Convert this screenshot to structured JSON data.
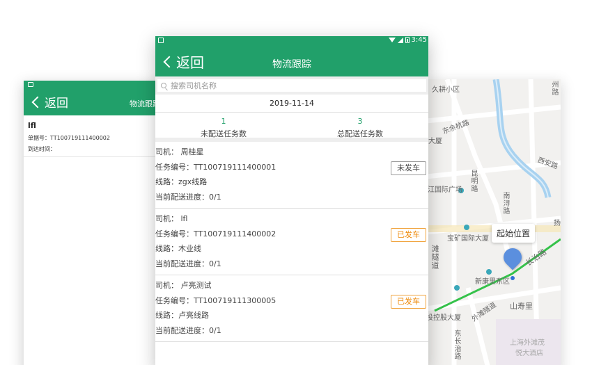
{
  "back_screen": {
    "back_label": "返回",
    "title": "物流跟踪",
    "detail": {
      "name": "lfl",
      "waybill_label": "单据号：",
      "waybill_value": "TT100719111400002",
      "arrival_label": "到达时间："
    }
  },
  "main_screen": {
    "status": {
      "time": "3:45"
    },
    "back_label": "返回",
    "title": "物流跟踪",
    "search": {
      "placeholder": "搜索司机名称"
    },
    "date": "2019-11-14",
    "stats": [
      {
        "value": "1",
        "label": "未配送任务数"
      },
      {
        "value": "3",
        "label": "总配送任务数"
      }
    ],
    "tasks": [
      {
        "driver": "司机： 周桂星",
        "task_no": "任务编号：TT100719111400001",
        "route": "线路：zgx线路",
        "progress": "当前配送进度：0/1",
        "status": "未发车",
        "status_type": "pending"
      },
      {
        "driver": "司机： lfl",
        "task_no": "任务编号：TT100719111400002",
        "route": "线路：木业线",
        "progress": "当前配送进度：0/1",
        "status": "已发车",
        "status_type": "sent"
      },
      {
        "driver": "司机： 卢亮测试",
        "task_no": "任务编号：TT100719111300005",
        "route": "线路：卢亮线路",
        "progress": "当前配送进度：0/1",
        "status": "已发车",
        "status_type": "sent"
      }
    ]
  },
  "map_screen": {
    "start_label": "起始位置",
    "labels": {
      "l1": "久耕小区",
      "l2": "州路",
      "l3": "东余杭路",
      "l4": "大厦",
      "l5": "西安路",
      "l6": "昆明路",
      "l7": "江国际广场",
      "l8": "南浔路",
      "l9": "宝矿国际大厦",
      "l10": "长治路",
      "l11": "新康里东区",
      "l12": "滩隧道",
      "l13": "外滩隧道",
      "l14": "山寿里",
      "l15": "投控股大厦",
      "l16": "上海外滩茂",
      "l17": "悦大酒店",
      "l18": "东长治路",
      "l19": "扬"
    }
  },
  "colors": {
    "brand_green": "#21a06a",
    "badge_orange": "#ee8a0a",
    "route_green": "#35c24a",
    "pin_blue": "#5b8fde"
  }
}
